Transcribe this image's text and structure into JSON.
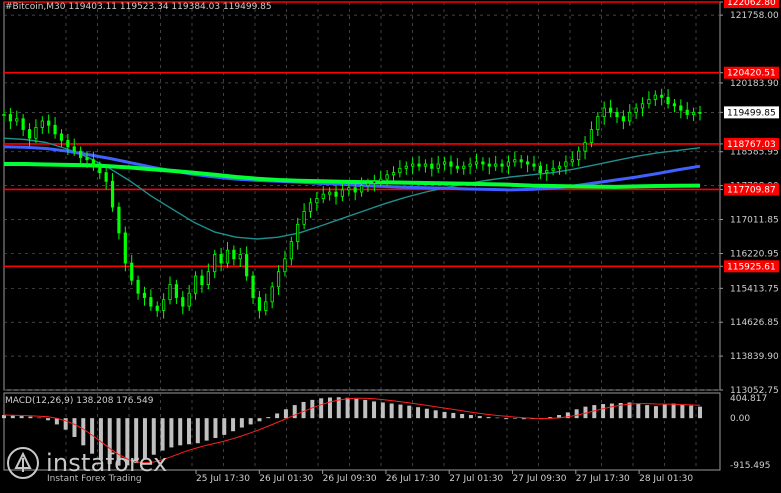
{
  "header": {
    "symbol_label": "#Bitcoin,M30",
    "ohlc": "119403.11 119523.34 119384.03 119499.85"
  },
  "price_axis": {
    "ticks": [
      "122062.80",
      "121758.00",
      "120420.51",
      "120183.90",
      "119499.85",
      "118767.03",
      "118585.95",
      "117798.90",
      "117709.87",
      "117011.85",
      "116220.95",
      "115925.61",
      "115413.75",
      "114626.85",
      "113839.90",
      "113052.75"
    ]
  },
  "time_axis": {
    "labels": [
      "25 Jul 17:30",
      "26 Jul 01:30",
      "26 Jul 09:30",
      "26 Jul 17:30",
      "27 Jul 01:30",
      "27 Jul 09:30",
      "27 Jul 17:30",
      "28 Jul 01:30"
    ]
  },
  "macd": {
    "label": "MACD(12,26,9) 138.208 176.549",
    "ticks": [
      "404.817",
      "0.00",
      "-915.495"
    ]
  },
  "watermark": {
    "brand": "instaforex",
    "tagline": "Instant Forex Trading"
  },
  "colors": {
    "background": "#000000",
    "candle": "#00ff00",
    "resistance_line": "#ff0000",
    "ma_fast": "#00ff33",
    "ma_mid": "#4060ff",
    "ma_slow": "#1f8f8f",
    "macd_hist": "#c0c0c0",
    "macd_signal": "#ff2020",
    "current_price_badge": "#ffffff"
  },
  "chart_data": {
    "type": "candlestick",
    "ylim": [
      113052.75,
      122062.8
    ],
    "horizontal_levels": [
      122062.8,
      120420.51,
      118767.03,
      117709.87,
      115925.61
    ],
    "current_price": 119499.85,
    "close_series": [
      119450,
      119300,
      119350,
      119100,
      118900,
      119150,
      119300,
      119200,
      119000,
      118850,
      118700,
      118600,
      118450,
      118400,
      118250,
      118100,
      117900,
      117300,
      116700,
      116000,
      115600,
      115300,
      115200,
      115000,
      114900,
      115150,
      115500,
      115200,
      115000,
      115300,
      115700,
      115500,
      115800,
      116200,
      116000,
      116300,
      116100,
      116200,
      115700,
      115200,
      114900,
      115100,
      115450,
      115800,
      116100,
      116500,
      116900,
      117200,
      117400,
      117500,
      117600,
      117650,
      117550,
      117700,
      117750,
      117650,
      117800,
      117850,
      117900,
      117950,
      118050,
      118100,
      118200,
      118250,
      118300,
      118250,
      118300,
      118200,
      118300,
      118350,
      118250,
      118200,
      118250,
      118300,
      118350,
      118300,
      118250,
      118300,
      118250,
      118350,
      118400,
      118350,
      118300,
      118250,
      118100,
      118150,
      118200,
      118250,
      118350,
      118400,
      118600,
      118800,
      119100,
      119400,
      119600,
      119500,
      119400,
      119300,
      119500,
      119600,
      119700,
      119800,
      119900,
      119850,
      119700,
      119650,
      119550,
      119450,
      119500,
      119499.85
    ],
    "ma_fast": [
      118300,
      118300,
      118290,
      118280,
      118270,
      118250,
      118220,
      118180,
      118140,
      118100,
      118050,
      118000,
      117960,
      117930,
      117910,
      117900,
      117890,
      117880,
      117875,
      117870,
      117860,
      117850,
      117840,
      117830,
      117820,
      117800,
      117790,
      117780,
      117775,
      117770,
      117780,
      117790,
      117795,
      117800
    ],
    "ma_mid": [
      118700,
      118690,
      118660,
      118600,
      118520,
      118430,
      118330,
      118230,
      118140,
      118060,
      118000,
      117950,
      117920,
      117900,
      117880,
      117850,
      117830,
      117800,
      117780,
      117760,
      117750,
      117740,
      117720,
      117710,
      117700,
      117710,
      117740,
      117790,
      117860,
      117930,
      118000,
      118080,
      118170,
      118250
    ],
    "ma_slow": [
      118900,
      118870,
      118800,
      118650,
      118450,
      118200,
      117900,
      117550,
      117250,
      116950,
      116720,
      116600,
      116560,
      116600,
      116700,
      116860,
      117030,
      117200,
      117370,
      117520,
      117650,
      117760,
      117850,
      117930,
      118000,
      118050,
      118100,
      118180,
      118280,
      118380,
      118480,
      118560,
      118620,
      118680
    ],
    "macd_hist": [
      60,
      50,
      40,
      30,
      10,
      -40,
      -120,
      -220,
      -360,
      -520,
      -680,
      -800,
      -880,
      -910,
      -900,
      -860,
      -780,
      -700,
      -620,
      -560,
      -520,
      -500,
      -480,
      -430,
      -380,
      -320,
      -250,
      -180,
      -120,
      -60,
      20,
      90,
      170,
      250,
      310,
      350,
      380,
      395,
      400,
      390,
      370,
      350,
      320,
      300,
      280,
      260,
      240,
      210,
      180,
      150,
      120,
      100,
      80,
      60,
      40,
      20,
      10,
      0,
      -10,
      -20,
      -15,
      0,
      20,
      60,
      110,
      170,
      220,
      250,
      270,
      280,
      290,
      300,
      280,
      250,
      230,
      260,
      280,
      260,
      240,
      220
    ]
  }
}
